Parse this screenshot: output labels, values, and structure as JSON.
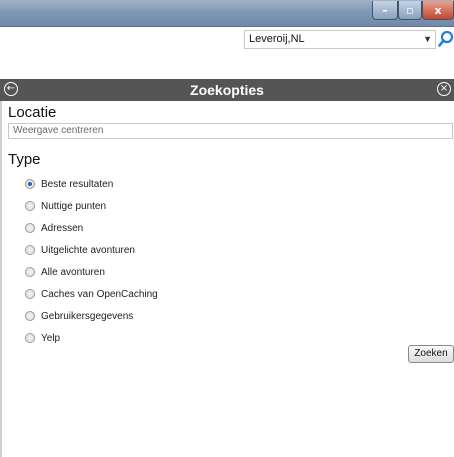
{
  "window": {
    "minimize_glyph": "–",
    "maximize_glyph": "▫",
    "close_glyph": "x"
  },
  "toolbar": {
    "location_value": "Leveroij,NL",
    "search_icon": "magnifier-icon"
  },
  "panel": {
    "title": "Zoekopties",
    "back_icon": "back-arrow-icon",
    "close_icon": "close-circle-icon"
  },
  "location": {
    "label": "Locatie",
    "placeholder": "Weergave centreren"
  },
  "type": {
    "label": "Type",
    "options": [
      {
        "label": "Beste resultaten",
        "checked": true
      },
      {
        "label": "Nuttige punten",
        "checked": false
      },
      {
        "label": "Adressen",
        "checked": false
      },
      {
        "label": "Uitgelichte avonturen",
        "checked": false
      },
      {
        "label": "Alle avonturen",
        "checked": false
      },
      {
        "label": "Caches van OpenCaching",
        "checked": false
      },
      {
        "label": "Gebruikersgegevens",
        "checked": false
      },
      {
        "label": "Yelp",
        "checked": false
      }
    ]
  },
  "actions": {
    "search_label": "Zoeken"
  },
  "colors": {
    "header_bg": "#555555",
    "accent": "#2a5fb0"
  }
}
